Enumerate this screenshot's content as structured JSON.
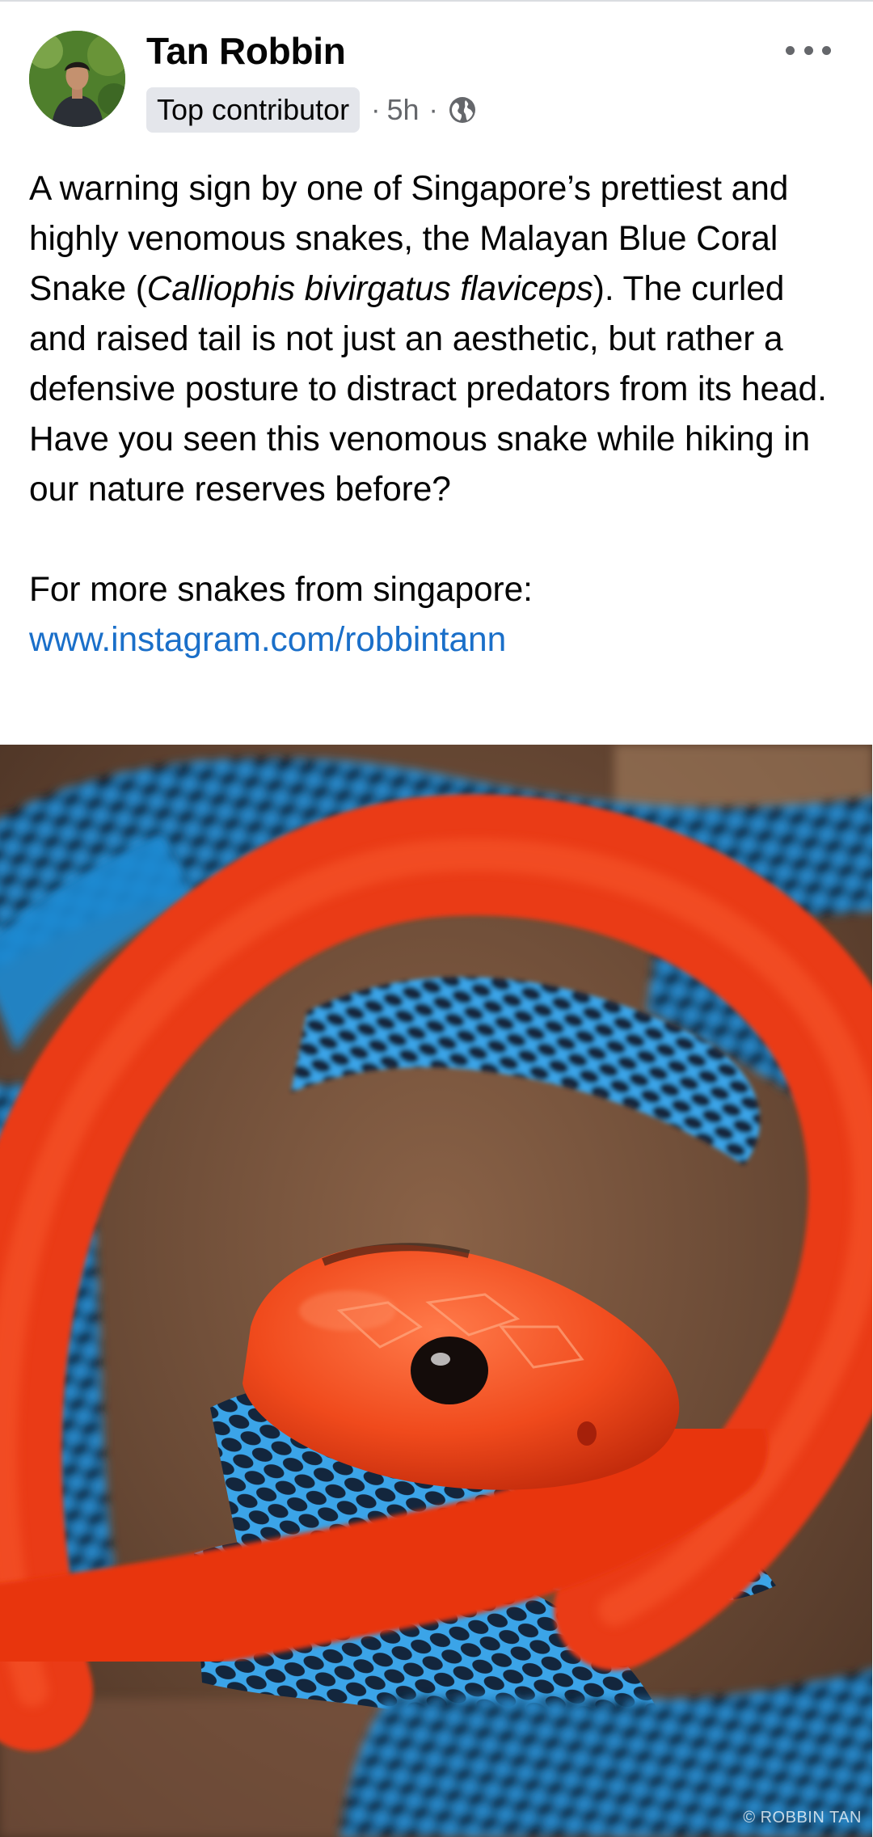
{
  "author": {
    "name": "Tan Robbin",
    "badge": "Top contributor",
    "time": "5h",
    "audience_icon": "globe-icon"
  },
  "post": {
    "text_part1": "A warning sign by one of Singapore’s prettiest and highly venomous snakes, the Malayan Blue Coral Snake (",
    "text_italic": "Calliophis bivirgatus flaviceps",
    "text_part2": "). The curled and raised tail is not just an aesthetic, but rather a defensive posture to distract predators from its head. Have you seen this venomous snake while hiking in our nature reserves before?",
    "text_more": "For more snakes from singapore:",
    "link": "www.instagram.com/robbintann"
  },
  "photo": {
    "watermark": "© ROBBIN TAN"
  },
  "colors": {
    "link": "#1a6fc9",
    "badge_bg": "#e4e6eb",
    "meta_gray": "#65676b",
    "snake_red": "#ec3d16",
    "snake_blue": "#2d8fd2"
  }
}
